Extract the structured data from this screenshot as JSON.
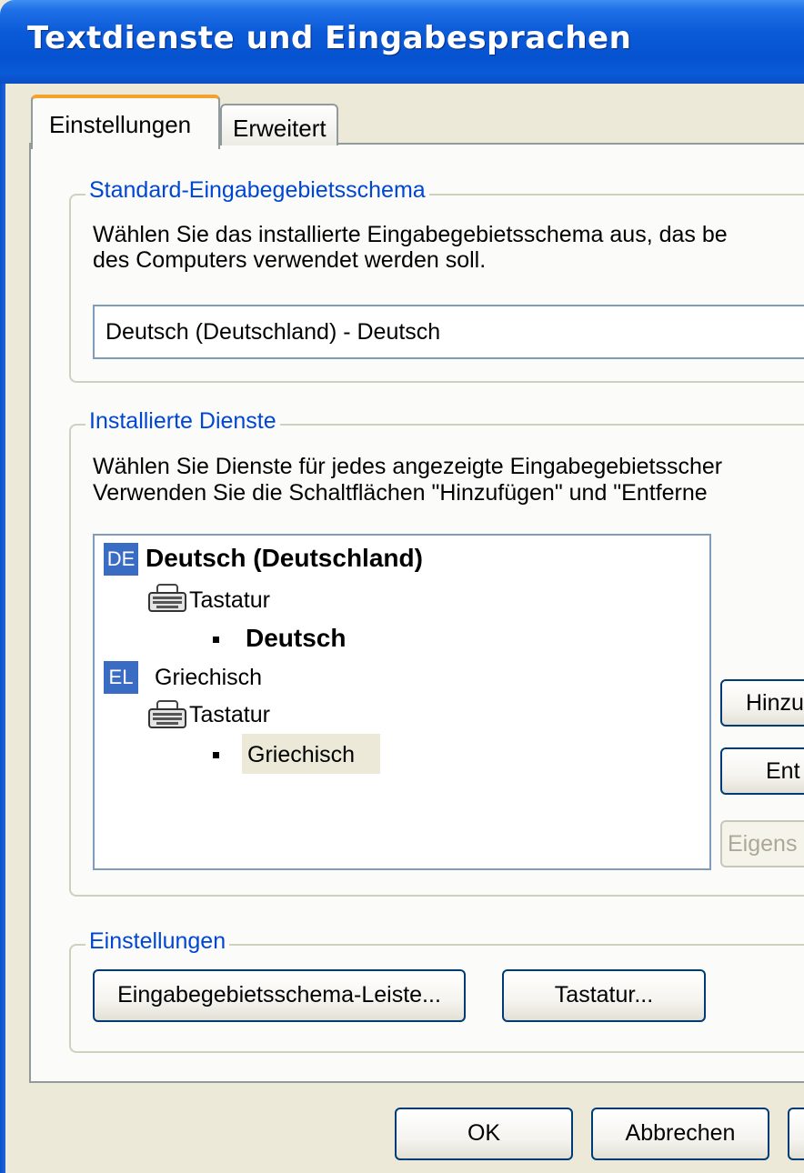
{
  "window": {
    "title": "Textdienste und Eingabesprachen"
  },
  "tabs": [
    {
      "label": "Einstellungen",
      "active": true
    },
    {
      "label": "Erweitert",
      "active": false
    }
  ],
  "default_group": {
    "legend": "Standard-Eingabegebietsschema",
    "description_line1": "Wählen Sie das installierte Eingabegebietsschema aus, das be",
    "description_line2": "des Computers verwendet werden soll.",
    "selected": "Deutsch (Deutschland) - Deutsch"
  },
  "services_group": {
    "legend": "Installierte Dienste",
    "description_line1": "Wählen Sie Dienste für jedes angezeigte Eingabegebietsscher",
    "description_line2": "Verwenden Sie die Schaltflächen \"Hinzufügen\" und \"Entferne",
    "tree": {
      "lang1": {
        "code": "DE",
        "name": "Deutsch (Deutschland)",
        "category": "Tastatur",
        "layout": "Deutsch"
      },
      "lang2": {
        "code": "EL",
        "name": "Griechisch",
        "category": "Tastatur",
        "layout": "Griechisch"
      }
    },
    "buttons": {
      "add": "Hinzu",
      "remove": "Ent",
      "properties": "Eigens"
    }
  },
  "settings_group": {
    "legend": "Einstellungen",
    "language_bar_button": "Eingabegebietsschema-Leiste...",
    "keyboard_button": "Tastatur..."
  },
  "footer": {
    "ok": "OK",
    "cancel": "Abbrechen"
  }
}
